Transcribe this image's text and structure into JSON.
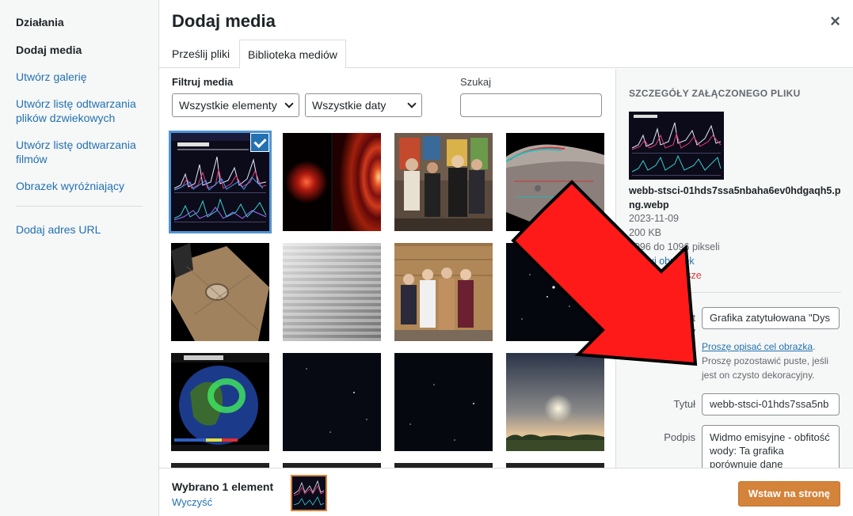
{
  "sidebar": {
    "heading": "Działania",
    "items": [
      {
        "label": "Dodaj media"
      },
      {
        "label": "Utwórz galerię"
      },
      {
        "label": "Utwórz listę odtwarzania plików dzwiekowych"
      },
      {
        "label": "Utwórz listę odtwarzania filmów"
      },
      {
        "label": "Obrazek wyróżniający"
      },
      {
        "label": "Dodaj adres URL"
      }
    ]
  },
  "modal": {
    "title": "Dodaj media",
    "close_icon": "×",
    "tabs": [
      "Prześlij pliki",
      "Biblioteka mediów"
    ]
  },
  "browser": {
    "filter_label": "Filtruj media",
    "type_filter": "Wszystkie elementy",
    "date_filter": "Wszystkie daty",
    "search_label": "Szukaj",
    "search_value": ""
  },
  "details": {
    "heading": "Szczegóły załączonego pliku",
    "filename": "webb-stsci-01hds7ssa5nbaha6ev0hdgaqh5.png.webp",
    "date": "2023-11-09",
    "size": "200 KB",
    "dimensions": "1096 do 1096 pikseli",
    "edit_link": "Edytuj obrazek",
    "delete_link": "Usuń na zawsze",
    "alt_label": "Tekst alternatywny",
    "alt_value": "Grafika zatytułowana \"Dys",
    "alt_help_link": "Proszę opisać cel obrazka",
    "alt_help_text": ". Proszę pozostawić puste, jeśli jest on czysto dekoracyjny.",
    "title_label": "Tytuł",
    "title_value": "webb-stsci-01hds7ssa5nb",
    "caption_label": "Podpis",
    "caption_value": "Widmo emisyjne - obfitość wody: Ta grafika porównuje dane"
  },
  "toolbar": {
    "selected_count": "Wybrano 1 element",
    "clear": "Wyczyść",
    "insert_button": "Wstaw na stronę"
  },
  "colors": {
    "link": "#2271b1",
    "accent": "#d4833b",
    "delete": "#d63638",
    "selection": "#4f94d4"
  }
}
